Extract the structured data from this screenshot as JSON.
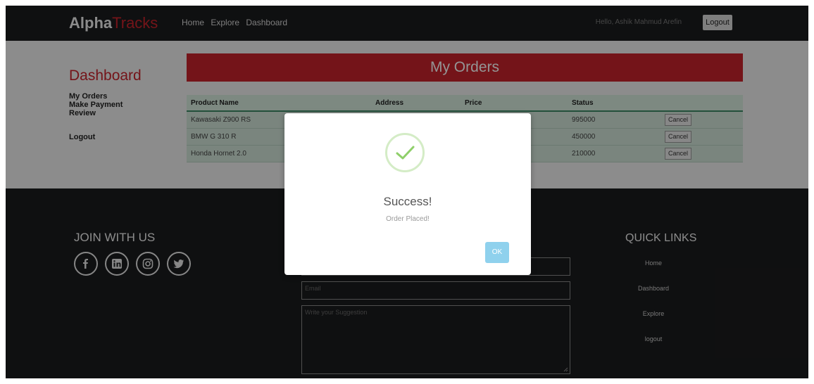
{
  "nav": {
    "brand_main": "Alpha",
    "brand_accent": "Tracks",
    "links": [
      "Home",
      "Explore",
      "Dashboard"
    ],
    "greeting": "Hello, Ashik Mahmud Arefin",
    "logout_label": "Logout"
  },
  "sidebar": {
    "title": "Dashboard",
    "items": [
      "My Orders",
      "Make Payment",
      "Review"
    ],
    "logout": "Logout"
  },
  "orders": {
    "banner": "My Orders",
    "headers": [
      "Product Name",
      "Address",
      "Price",
      "Status",
      ""
    ],
    "rows": [
      {
        "product": "Kawasaki Z900 RS",
        "price": "995000",
        "action": "Cancel"
      },
      {
        "product": "BMW G 310 R",
        "price": "450000",
        "action": "Cancel"
      },
      {
        "product": "Honda Hornet 2.0",
        "price": "210000",
        "action": "Cancel"
      }
    ]
  },
  "footer": {
    "join_title": "JOIN WITH US",
    "social_icons": [
      "facebook-icon",
      "linkedin-icon",
      "instagram-icon",
      "twitter-icon"
    ],
    "email_placeholder": "Email",
    "suggestion_placeholder": "Write your Suggestion",
    "quick_title": "QUICK LINKS",
    "quick_links": [
      "Home",
      "Dashboard",
      "Explore",
      "logout"
    ]
  },
  "modal": {
    "title": "Success!",
    "text": "Order Placed!",
    "ok_label": "OK",
    "icon": "checkmark-icon"
  },
  "colors": {
    "accent": "#c8232c",
    "dark_bg": "#1b1c1e",
    "table_header": "#d7ecdf",
    "ok_button": "#8fd1ed"
  }
}
